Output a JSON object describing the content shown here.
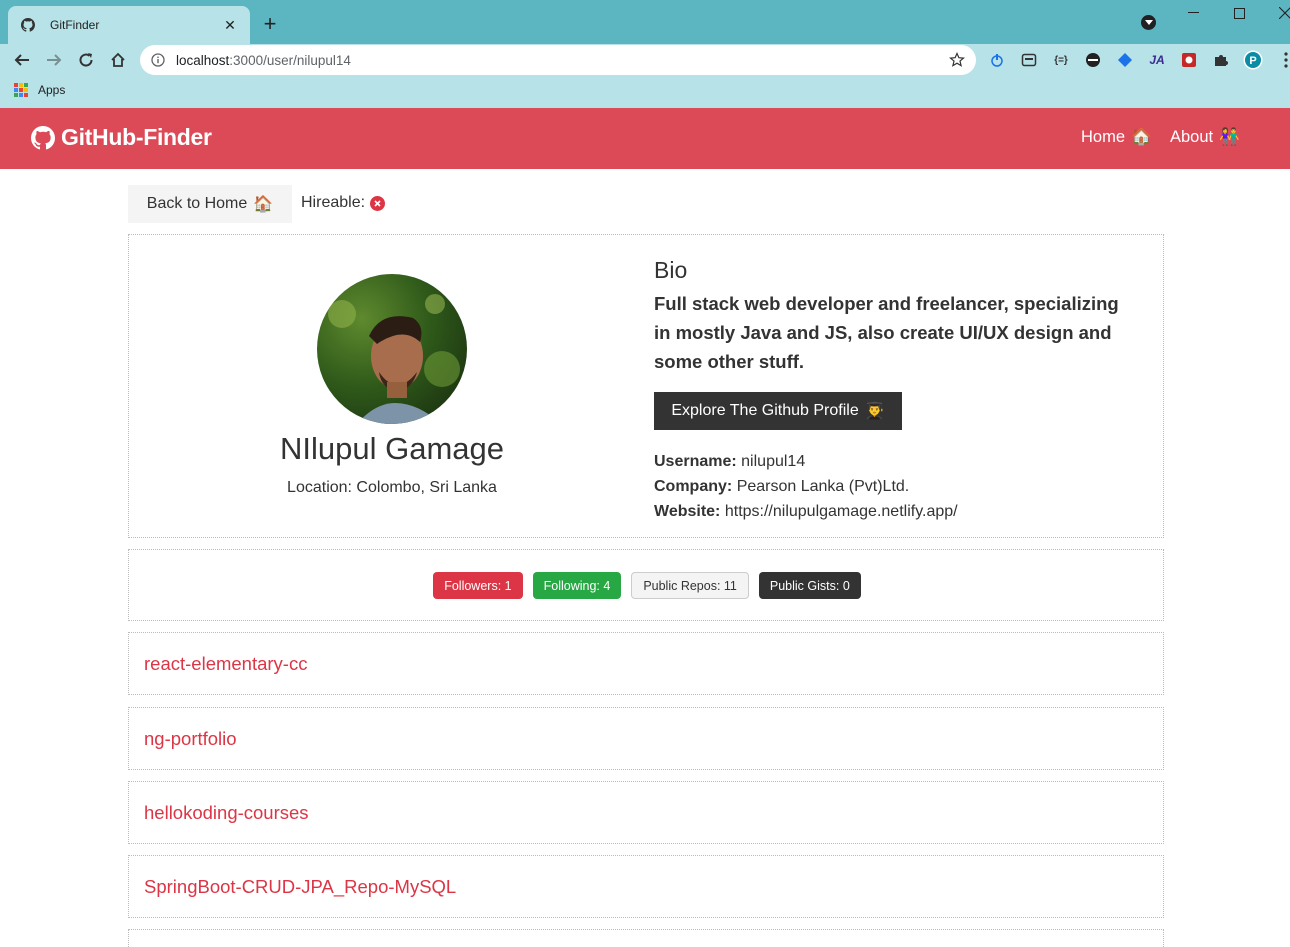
{
  "browser": {
    "tab_title": "GitFinder",
    "url_host": "localhost",
    "url_path": ":3000/user/nilupul14",
    "bookmark_apps": "Apps"
  },
  "navbar": {
    "brand": "GitHub-Finder",
    "links": [
      {
        "label": "Home",
        "emoji": "🏠"
      },
      {
        "label": "About",
        "emoji": "👫"
      }
    ]
  },
  "actions": {
    "back_label": "Back to Home",
    "back_emoji": "🏠",
    "hireable_label": "Hireable:"
  },
  "profile": {
    "name": "NIlupul Gamage",
    "location": "Location: Colombo, Sri Lanka",
    "bio_title": "Bio",
    "bio": "Full stack web developer and freelancer, specializing in mostly Java and JS, also create UI/UX design and some other stuff.",
    "explore_label": "Explore The Github Profile",
    "explore_emoji": "👨‍🎓",
    "username_label": "Username:",
    "username": "nilupul14",
    "company_label": "Company:",
    "company": "Pearson Lanka (Pvt)Ltd.",
    "website_label": "Website:",
    "website": "https://nilupulgamage.netlify.app/"
  },
  "stats": {
    "followers": "Followers: 1",
    "following": "Following: 4",
    "public_repos": "Public Repos: 11",
    "public_gists": "Public Gists: 0"
  },
  "repos": [
    "react-elementary-cc",
    "ng-portfolio",
    "hellokoding-courses",
    "SpringBoot-CRUD-JPA_Repo-MySQL"
  ],
  "colors": {
    "primary": "#dc4a58",
    "danger": "#dc3545",
    "success": "#28a745",
    "dark": "#333333",
    "light": "#f4f4f4"
  }
}
